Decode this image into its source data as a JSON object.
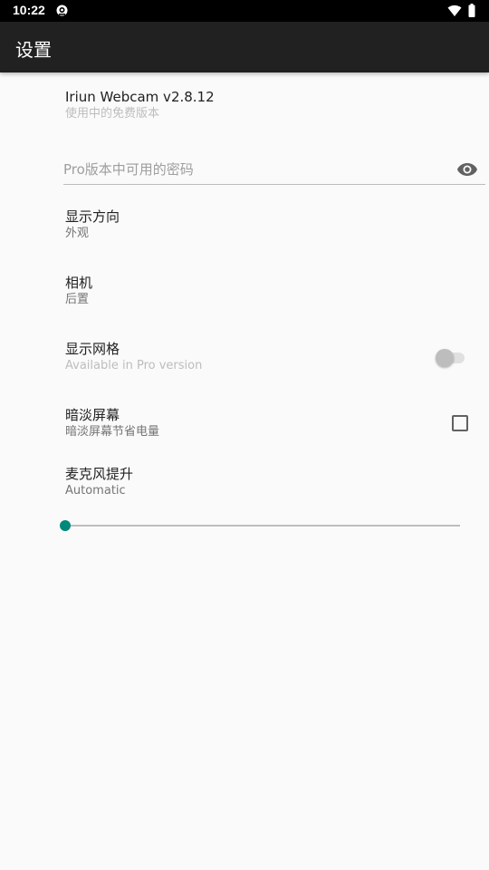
{
  "status_bar": {
    "time": "10:22"
  },
  "app_bar": {
    "title": "设置"
  },
  "version_pref": {
    "title": "Iriun Webcam v2.8.12",
    "summary": "使用中的免费版本"
  },
  "password_field": {
    "placeholder": "Pro版本中可用的密码",
    "value": ""
  },
  "orientation_pref": {
    "title": "显示方向",
    "summary": "外观"
  },
  "camera_pref": {
    "title": "相机",
    "summary": "后置"
  },
  "grid_pref": {
    "title": "显示网格",
    "summary": "Available in Pro version",
    "enabled": false
  },
  "dim_pref": {
    "title": "暗淡屏幕",
    "summary": "暗淡屏幕节省电量",
    "checked": false
  },
  "mic_pref": {
    "title": "麦克风提升",
    "summary": "Automatic",
    "level": 0
  },
  "colors": {
    "app_bar": "#212121",
    "accent": "#00897b",
    "background": "#fafafa"
  },
  "icons": {
    "password_toggle": "eye-icon",
    "notification": "notification-icon",
    "wifi": "wifi-icon",
    "battery": "battery-icon"
  }
}
